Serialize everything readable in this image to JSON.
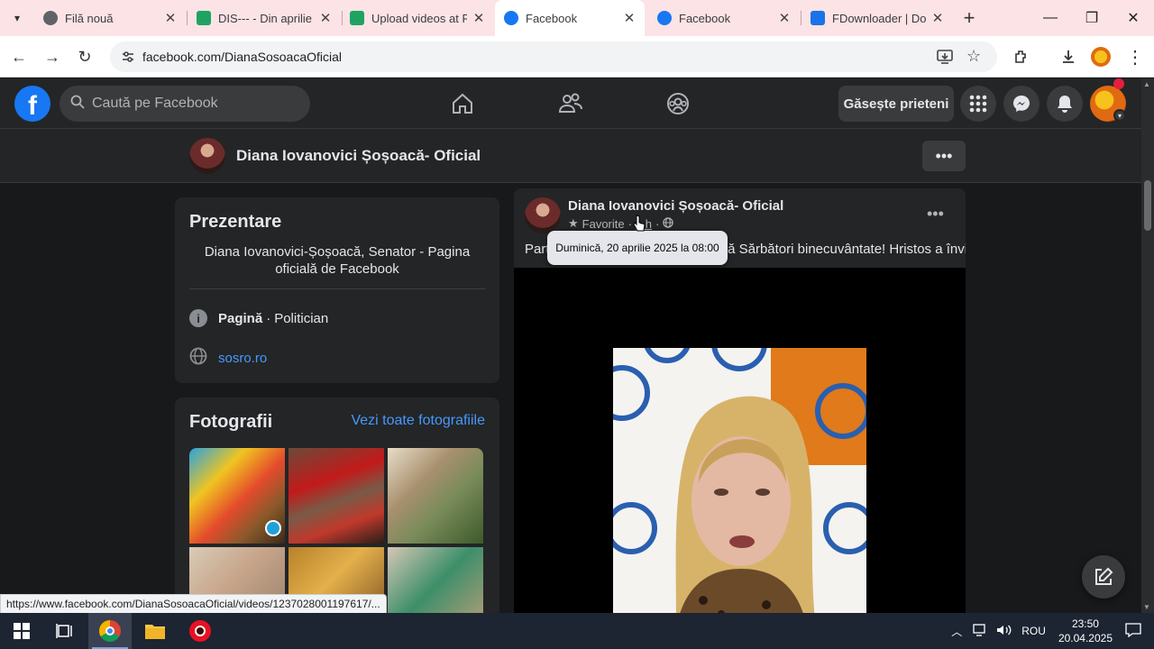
{
  "browser": {
    "tabs": [
      {
        "title": "Filă nouă",
        "icon": "chrome-icon",
        "color": "#5f6368"
      },
      {
        "title": "DIS--- - Din aprilie",
        "icon": "play-icon",
        "color": "#1ea362"
      },
      {
        "title": "Upload videos at R",
        "icon": "play-icon",
        "color": "#1ea362"
      },
      {
        "title": "Facebook",
        "icon": "facebook-icon",
        "color": "#1877f2"
      },
      {
        "title": "Facebook",
        "icon": "facebook-icon",
        "color": "#1877f2"
      },
      {
        "title": "FDownloader | Dow",
        "icon": "download-icon",
        "color": "#1a73e8"
      }
    ],
    "active_tab": 3,
    "url": "facebook.com/DianaSosoacaOficial",
    "status_url": "https://www.facebook.com/DianaSosoacaOficial/videos/1237028001197617/..."
  },
  "facebook": {
    "search_placeholder": "Caută pe Facebook",
    "find_friends": "Găsește prieteni",
    "brand_color": "#1877f2",
    "page": {
      "name": "Diana Iovanovici Șoșoacă- Oficial"
    },
    "intro": {
      "title": "Prezentare",
      "description": "Diana Iovanovici-Șoșoacă, Senator - Pagina oficială de Facebook",
      "category_label": "Pagină",
      "category_value": "Politician",
      "website": "sosro.ro"
    },
    "photos": {
      "title": "Fotografii",
      "see_all": "Vezi toate fotografiile"
    },
    "post": {
      "author": "Diana Iovanovici Șoșoacă- Oficial",
      "audience": "Favorite",
      "time": "1 h",
      "text": "Partidul S.O.S. România vă urează Sărbători binecuvântate! Hristos a înviat!",
      "tooltip": "Duminică, 20 aprilie 2025 la 08:00"
    }
  },
  "taskbar": {
    "language": "ROU",
    "time": "23:50",
    "date": "20.04.2025"
  }
}
